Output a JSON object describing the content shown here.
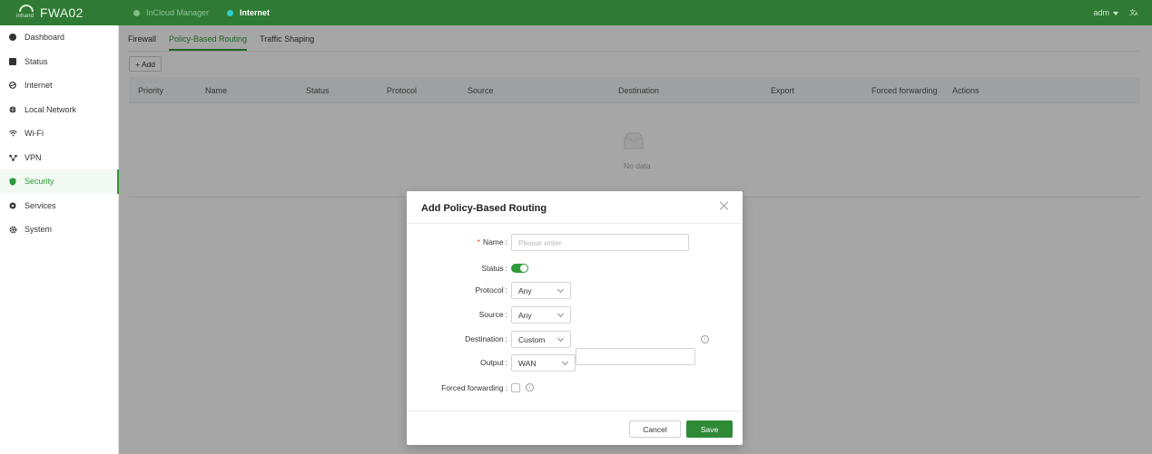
{
  "brand": {
    "logo_mark": "inhand",
    "product": "FWA02"
  },
  "topbar": {
    "tabs": [
      {
        "label": "InCloud Manager"
      },
      {
        "label": "Internet"
      }
    ],
    "user": "adm",
    "language_icon": "translate-icon"
  },
  "sidebar": {
    "items": [
      {
        "label": "Dashboard",
        "icon": "dashboard-icon"
      },
      {
        "label": "Status",
        "icon": "status-icon"
      },
      {
        "label": "Internet",
        "icon": "internet-icon"
      },
      {
        "label": "Local Network",
        "icon": "globe-icon"
      },
      {
        "label": "Wi-Fi",
        "icon": "wifi-icon"
      },
      {
        "label": "VPN",
        "icon": "vpn-icon"
      },
      {
        "label": "Security",
        "icon": "shield-icon"
      },
      {
        "label": "Services",
        "icon": "services-icon"
      },
      {
        "label": "System",
        "icon": "gear-icon"
      }
    ],
    "active": "Security"
  },
  "main": {
    "subtabs": [
      "Firewall",
      "Policy-Based Routing",
      "Traffic Shaping"
    ],
    "active_subtab": "Policy-Based Routing",
    "add_label": "+ Add",
    "table": {
      "columns": [
        "Priority",
        "Name",
        "Status",
        "Protocol",
        "Source",
        "Destination",
        "Export",
        "Forced forwarding",
        "Actions"
      ],
      "rows": [],
      "empty_text": "No data"
    }
  },
  "modal": {
    "title": "Add Policy-Based Routing",
    "fields": {
      "name": {
        "label": "Name",
        "required": true,
        "placeholder": "Please enter",
        "value": ""
      },
      "status": {
        "label": "Status",
        "enabled": true
      },
      "protocol": {
        "label": "Protocol",
        "value": "Any"
      },
      "source": {
        "label": "Source",
        "value": "Any"
      },
      "destination": {
        "label": "Destination",
        "value": "Custom",
        "custom_value": ""
      },
      "output": {
        "label": "Output",
        "value": "WAN"
      },
      "forced_forwarding": {
        "label": "Forced forwarding",
        "checked": false
      }
    },
    "cancel_label": "Cancel",
    "save_label": "Save"
  },
  "colors": {
    "topbar": "#2f7a34",
    "accent": "#2f9a3a",
    "required": "#e53935"
  }
}
